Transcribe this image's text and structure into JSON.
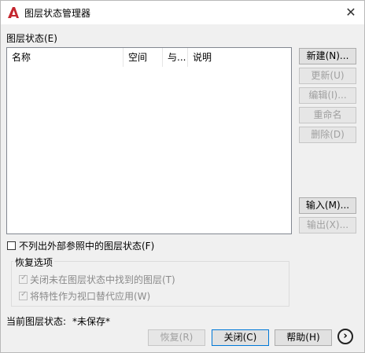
{
  "window": {
    "title": "图层状态管理器",
    "close_glyph": "✕",
    "icon": "autocad-logo-icon"
  },
  "layer_states": {
    "label": "图层状态(E)",
    "columns": [
      "名称",
      "空间",
      "与...",
      "说明"
    ],
    "rows": []
  },
  "side_buttons": {
    "new": "新建(N)...",
    "update": "更新(U)",
    "edit": "编辑(I)...",
    "rename": "重命名",
    "delete": "删除(D)",
    "import": "输入(M)...",
    "export": "输出(X)..."
  },
  "exclude_xref": {
    "label": "不列出外部参照中的图层状态(F)",
    "checked": false
  },
  "restore_options": {
    "title": "恢复选项",
    "turn_off_layers": {
      "label": "关闭未在图层状态中找到的图层(T)",
      "checked": true
    },
    "apply_as_override": {
      "label": "将特性作为视口替代应用(W)",
      "checked": true
    }
  },
  "current_state": {
    "label": "当前图层状态:",
    "value": "*未保存*"
  },
  "bottom_buttons": {
    "restore": "恢复(R)",
    "close": "关闭(C)",
    "help": "帮助(H)",
    "more": "›"
  },
  "colors": {
    "accent": "#c4262e",
    "disabled": "#a0a0a0"
  }
}
